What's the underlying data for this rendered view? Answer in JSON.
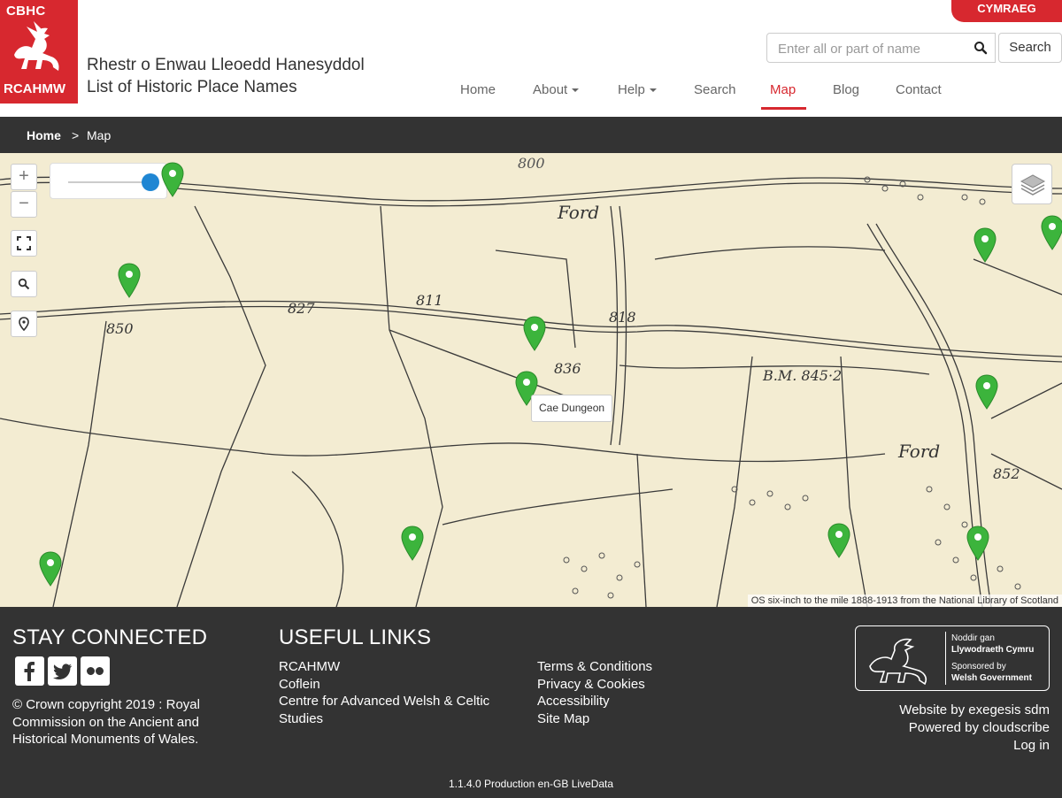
{
  "header": {
    "logo_top": "CBHC",
    "logo_bottom": "RCAHMW",
    "title_welsh": "Rhestr o Enwau Lleoedd Hanesyddol",
    "title_english": "List of Historic Place Names",
    "language_button": "CYMRAEG",
    "search_placeholder": "Enter all or part of name",
    "search_button": "Search"
  },
  "nav": {
    "items": [
      {
        "label": "Home"
      },
      {
        "label": "About"
      },
      {
        "label": "Help"
      },
      {
        "label": "Search"
      },
      {
        "label": "Map"
      },
      {
        "label": "Blog"
      },
      {
        "label": "Contact"
      }
    ],
    "active": "Map"
  },
  "breadcrumb": {
    "home": "Home",
    "separator": ">",
    "current": "Map"
  },
  "map": {
    "tooltip": "Cae Dungeon",
    "attribution": "OS six-inch to the mile 1888-1913 from the National Library of Scotland",
    "zoom_in": "+",
    "zoom_out": "−",
    "labels": [
      "Ford",
      "Ford",
      "811",
      "827",
      "850",
      "836",
      "818",
      "B.M. 845·2",
      "852",
      "800"
    ],
    "background_color": "#f3ecd2",
    "marker_color": "#3cb43c"
  },
  "footer": {
    "stay_connected": "STAY CONNECTED",
    "copyright": "© Crown copyright 2019 : Royal Commission on the Ancient and Historical Monuments of Wales.",
    "useful_links_title": "USEFUL LINKS",
    "links_col1": [
      "RCAHMW",
      "Coflein",
      "Centre for Advanced Welsh & Celtic Studies"
    ],
    "links_col2": [
      "Terms & Conditions",
      "Privacy & Cookies",
      "Accessibility",
      "Site Map"
    ],
    "gov": {
      "line1": "Noddir gan",
      "line2": "Llywodraeth Cymru",
      "line3": "Sponsored by",
      "line4": "Welsh Government"
    },
    "website_by": "Website by exegesis sdm",
    "powered_by": "Powered by cloudscribe",
    "login": "Log in",
    "version": "1.1.4.0  Production  en-GB  LiveData"
  }
}
